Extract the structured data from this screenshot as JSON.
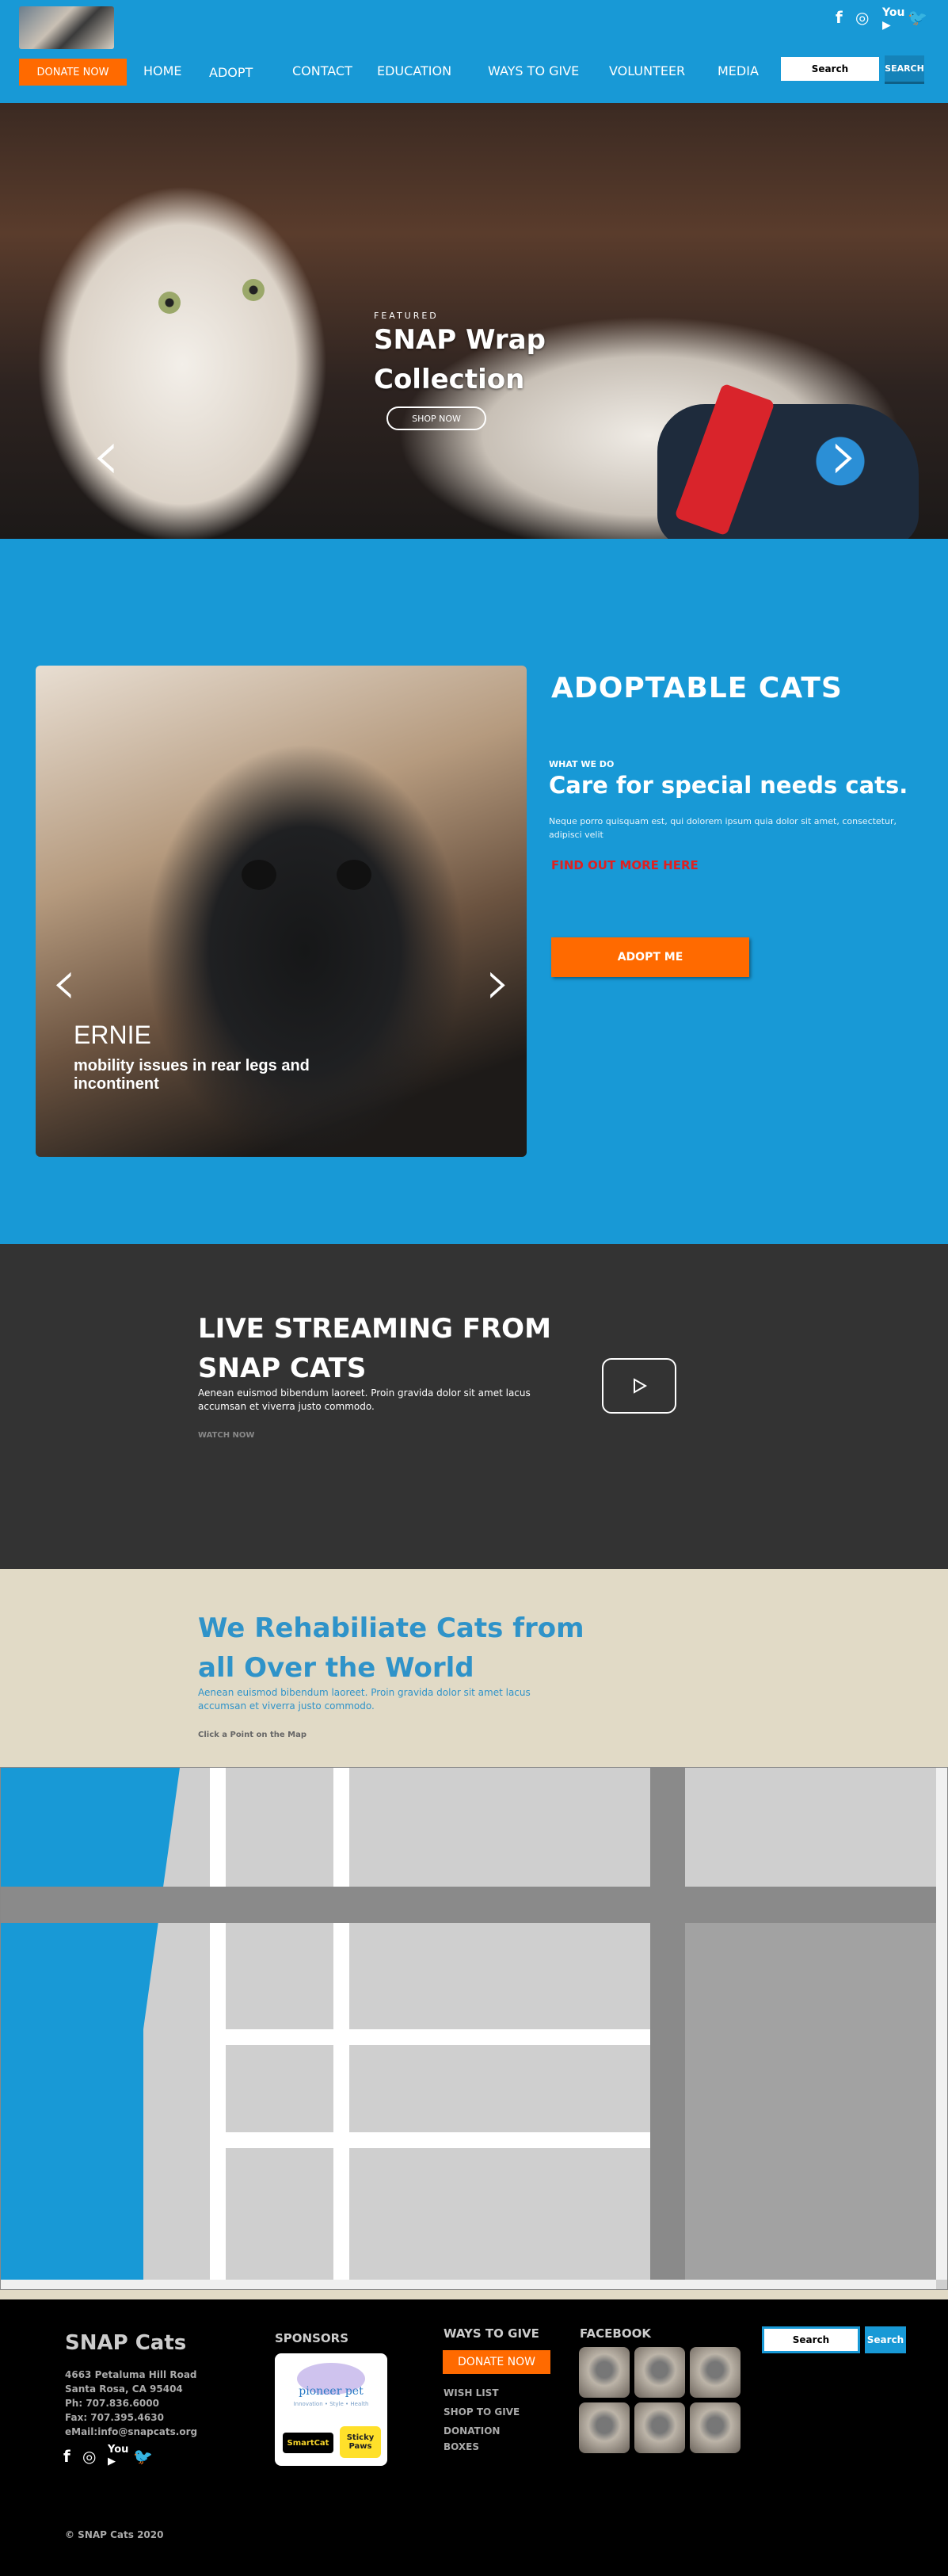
{
  "header": {
    "social": [
      "f",
      "◎",
      "▶",
      "🐦"
    ],
    "donate_label": "DONATE NOW",
    "nav": [
      "HOME",
      "ADOPT",
      "CONTACT",
      "EDUCATION",
      "WAYS TO GIVE",
      "VOLUNTEER",
      "MEDIA"
    ],
    "search_placeholder": "Search",
    "search_button": "SEARCH"
  },
  "hero": {
    "eyebrow": "FEATURED",
    "title_line1": "SNAP Wrap",
    "title_line2": "Collection",
    "cta": "SHOP NOW"
  },
  "adopt": {
    "heading": "ADOPTABLE CATS",
    "cat_name": "ERNIE",
    "cat_desc": "mobility issues in rear legs and incontinent",
    "eyebrow": "WHAT WE DO",
    "subheading": "Care for special needs cats.",
    "body": "Neque porro quisquam est, qui dolorem ipsum quia dolor sit amet, consectetur, adipisci velit",
    "find_out": "FIND OUT MORE HERE",
    "button": "ADOPT ME"
  },
  "live": {
    "heading": "LIVE STREAMING FROM SNAP CATS",
    "body": "Aenean euismod bibendum laoreet. Proin gravida dolor sit amet lacus accumsan et viverra justo commodo.",
    "link": "WATCH NOW"
  },
  "rehab": {
    "heading": "We Rehabiliate Cats from all Over the World",
    "body": "Aenean euismod bibendum laoreet. Proin gravida dolor sit amet lacus accumsan et viverra justo commodo.",
    "hint": "Click a Point on the Map"
  },
  "footer": {
    "title": "SNAP Cats",
    "address_lines": [
      "4663 Petaluma Hill Road",
      "Santa Rosa, CA 95404",
      "Ph: 707.836.6000",
      "Fax: 707.395.4630",
      "eMail:info@snapcats.org"
    ],
    "sponsors_heading": "SPONSORS",
    "sponsor_1": "pioneer pet",
    "sponsor_1_tag": "Innovation • Style • Health",
    "sponsor_2": "SmartCat",
    "sponsor_3": "Sticky Paws",
    "ways_heading": "WAYS TO GIVE",
    "donate_label": "DONATE NOW",
    "links": [
      "WISH LIST",
      "SHOP TO GIVE",
      "DONATION BOXES"
    ],
    "facebook_heading": "FACEBOOK",
    "search_placeholder": "Search",
    "search_button": "Search",
    "copyright": "© SNAP Cats 2020"
  }
}
